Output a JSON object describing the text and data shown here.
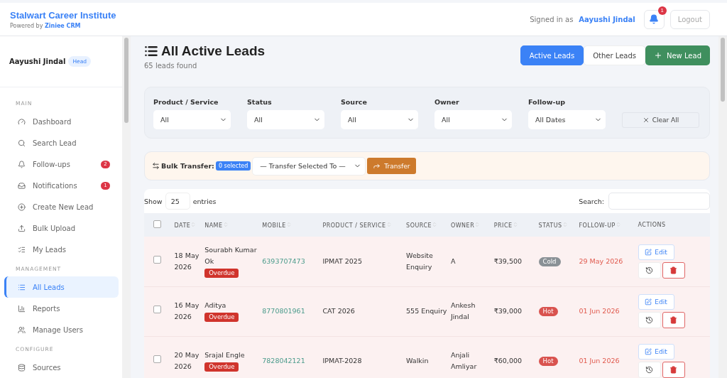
{
  "header": {
    "brand": "Stalwart Career Institute",
    "powered_prefix": "Powered by",
    "powered_name": "Ziniee CRM",
    "signed_in_label": "Signed in as",
    "user": "Aayushi Jindal",
    "notification_count": "1",
    "logout": "Logout"
  },
  "sidebar": {
    "user": "Aayushi Jindal",
    "role": "Head",
    "sections": [
      {
        "title": "MAIN",
        "items": [
          {
            "label": "Dashboard",
            "selected": false
          },
          {
            "label": "Search Lead",
            "selected": false
          },
          {
            "label": "Follow-ups",
            "badge": "2",
            "selected": false
          },
          {
            "label": "Notifications",
            "badge": "1",
            "selected": false
          },
          {
            "label": "Create New Lead",
            "selected": false
          },
          {
            "label": "Bulk Upload",
            "selected": false
          },
          {
            "label": "My Leads",
            "selected": false
          }
        ]
      },
      {
        "title": "MANAGEMENT",
        "items": [
          {
            "label": "All Leads",
            "selected": true
          },
          {
            "label": "Reports",
            "selected": false
          },
          {
            "label": "Manage Users",
            "selected": false
          }
        ]
      },
      {
        "title": "CONFIGURE",
        "items": [
          {
            "label": "Sources",
            "selected": false
          }
        ]
      }
    ]
  },
  "page": {
    "title": "All Active Leads",
    "subtitle": "65 leads found",
    "tabs": [
      {
        "label": "Active Leads",
        "selected": true
      },
      {
        "label": "Other Leads",
        "selected": false
      }
    ],
    "new_button": "New Lead"
  },
  "filters": {
    "fields": [
      {
        "label": "Product / Service",
        "value": "All"
      },
      {
        "label": "Status",
        "value": "All"
      },
      {
        "label": "Source",
        "value": "All"
      },
      {
        "label": "Owner",
        "value": "All"
      },
      {
        "label": "Follow-up",
        "value": "All Dates"
      }
    ],
    "clear": "Clear All"
  },
  "bulk": {
    "label": "Bulk Transfer:",
    "count": "0 selected",
    "select": "— Transfer Selected To —",
    "button": "Transfer"
  },
  "table": {
    "select_all_checked": false,
    "show": "Show",
    "entries_value": "25",
    "entries": "entries",
    "search_label": "Search:",
    "columns": [
      "DATE",
      "NAME",
      "MOBILE",
      "PRODUCT / SERVICE",
      "SOURCE",
      "OWNER",
      "PRICE",
      "STATUS",
      "FOLLOW-UP",
      "ACTIONS"
    ],
    "rows": [
      {
        "checked": false,
        "date": "18 May 2026",
        "name": "Sourabh Kumar Ok",
        "tag": "Overdue",
        "mobile": "6393707473",
        "product": "IPMAT 2025",
        "source": "Website Enquiry",
        "owner": "A",
        "price": "₹39,500",
        "status": "Cold",
        "color": "#8a9196",
        "follow_up": "29 May 2026",
        "edit": "Edit"
      },
      {
        "checked": false,
        "date": "16 May 2026",
        "name": "Aditya",
        "tag": "Overdue",
        "mobile": "8770801961",
        "product": "CAT 2026",
        "source": "555 Enquiry",
        "owner": "Ankesh Jindal",
        "price": "₹39,000",
        "status": "Hot",
        "color": "#d9534f",
        "follow_up": "01 Jun 2026",
        "edit": "Edit"
      },
      {
        "checked": false,
        "date": "20 May 2026",
        "name": "Srajal Engle",
        "tag": "Overdue",
        "mobile": "7828042121",
        "product": "IPMAT-2028",
        "source": "Walkin",
        "owner": "Anjali Amliyar",
        "price": "₹60,000",
        "status": "Hot",
        "color": "#d9534f",
        "follow_up": "01 Jun 2026",
        "edit": "Edit"
      }
    ]
  }
}
